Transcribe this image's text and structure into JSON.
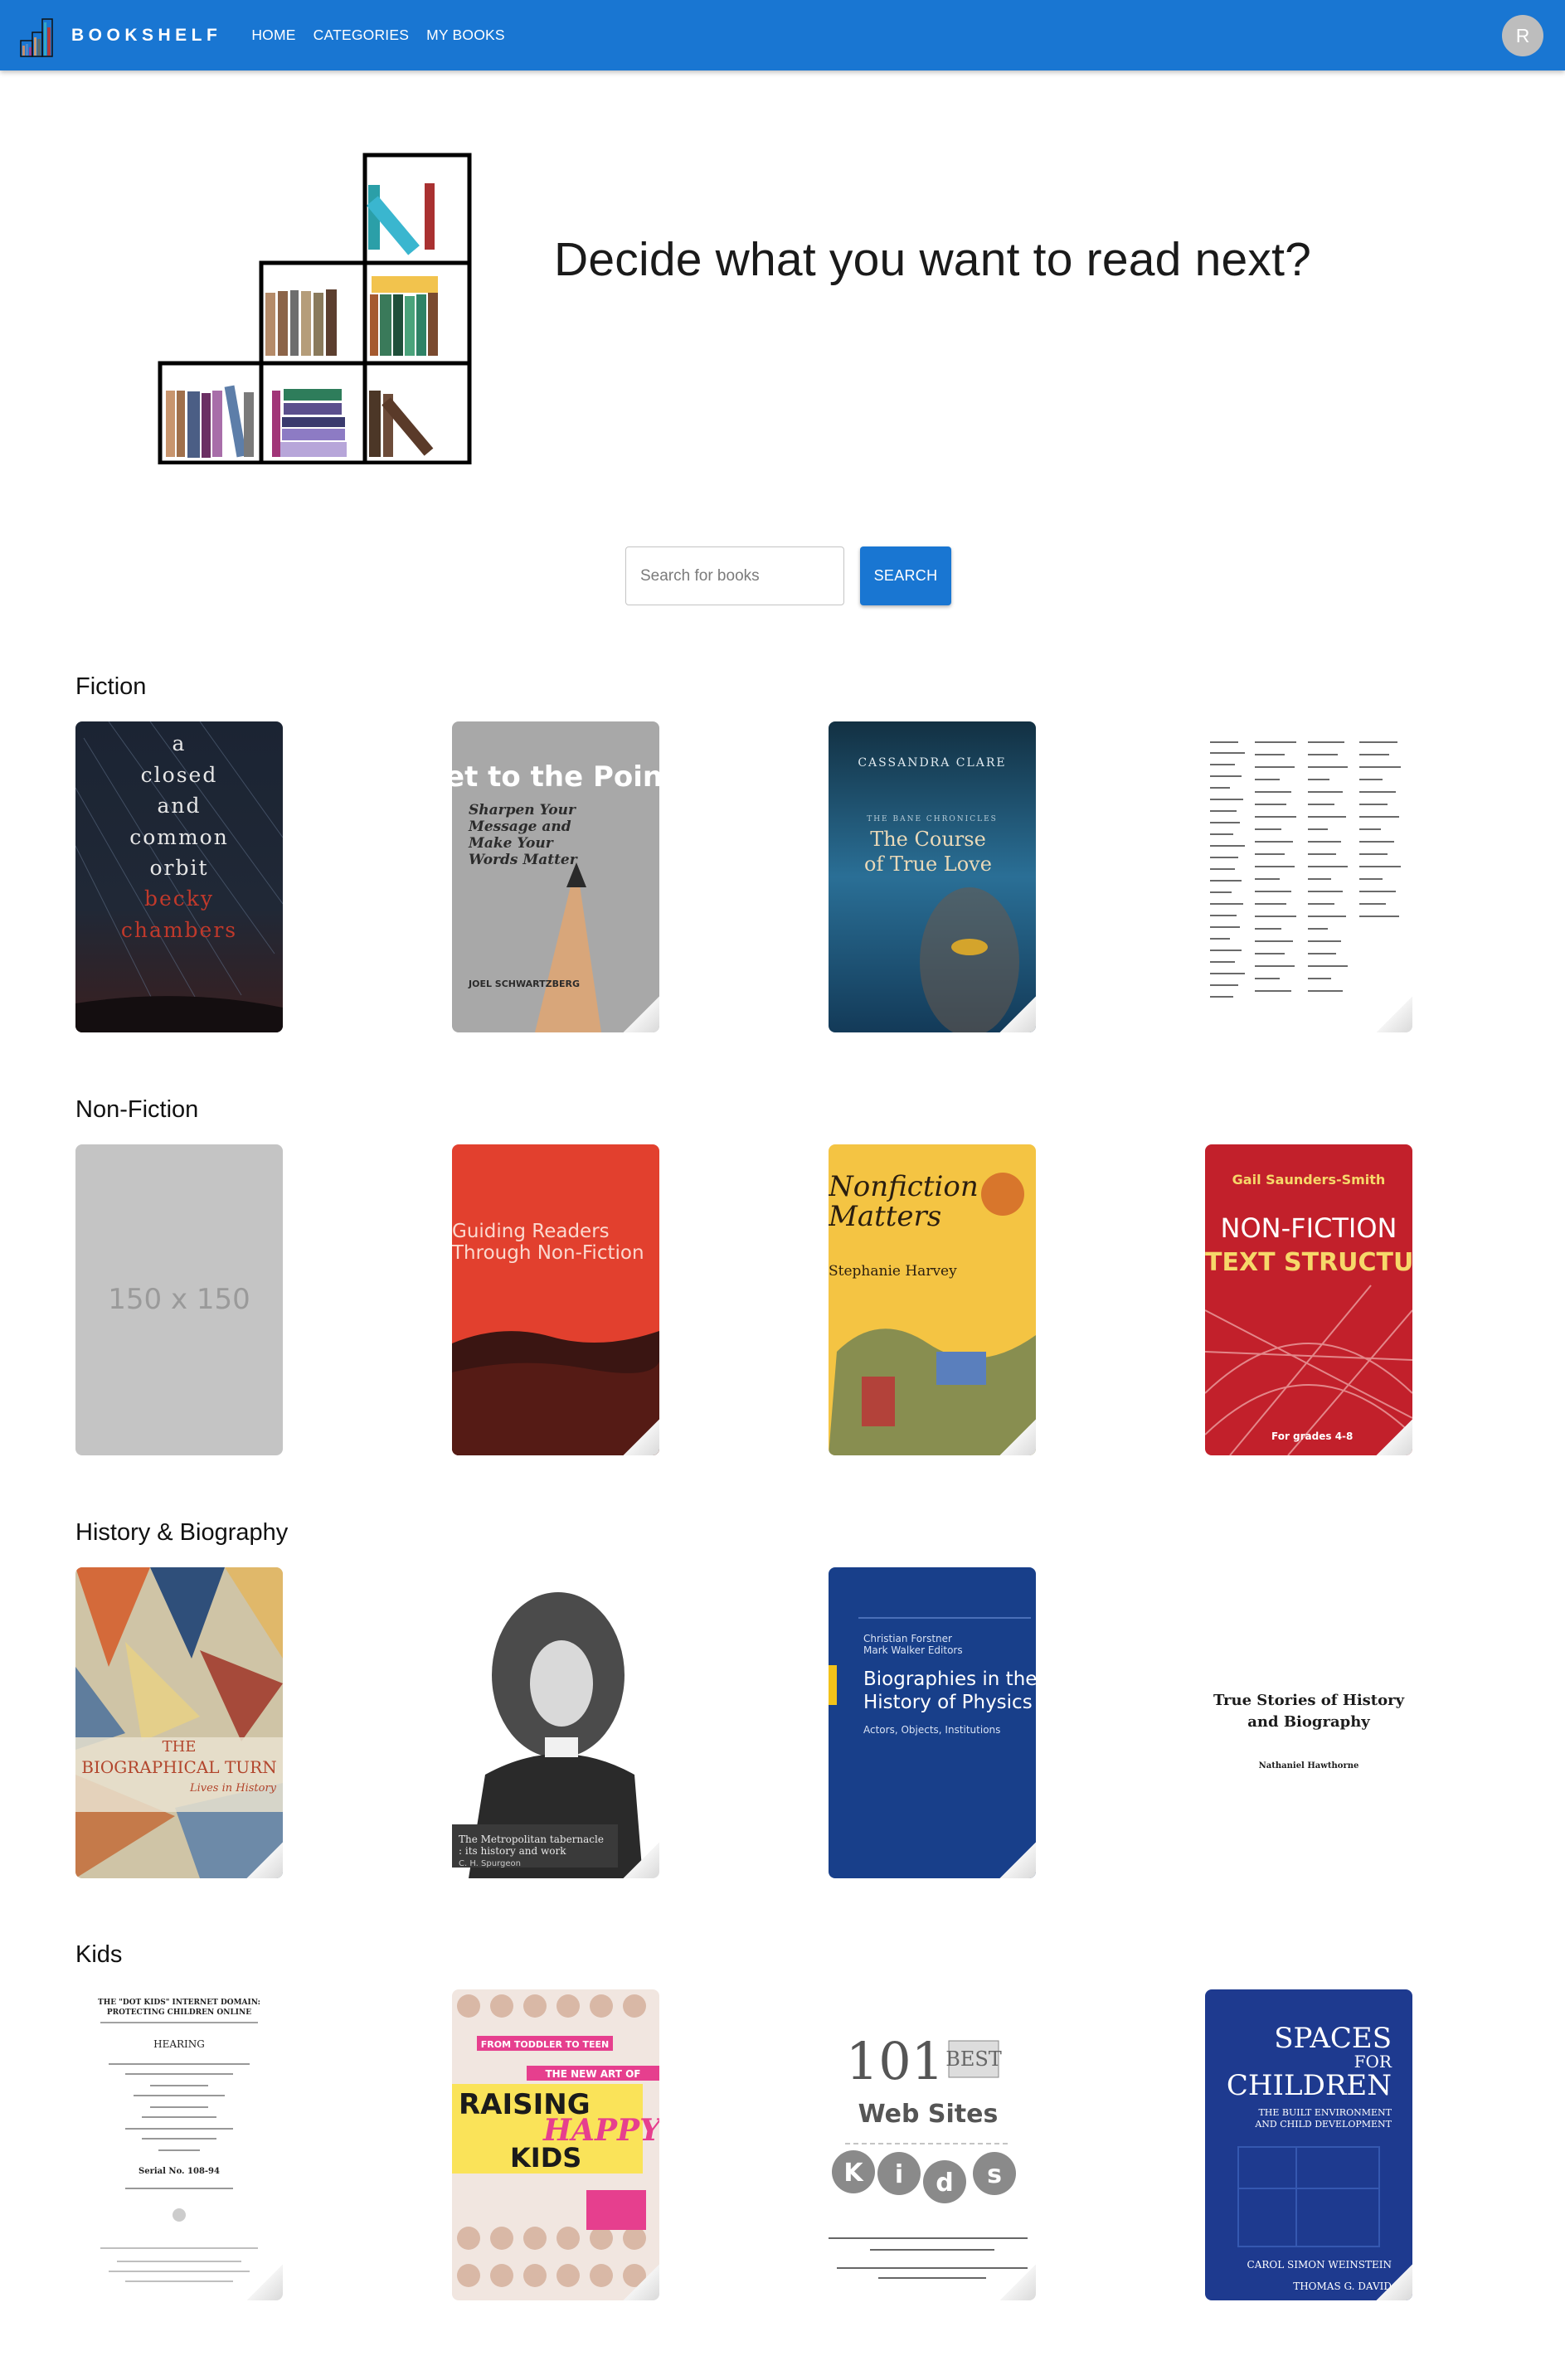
{
  "app": {
    "brand": "BOOKSHELF",
    "nav": [
      "HOME",
      "CATEGORIES",
      "MY BOOKS"
    ],
    "avatar_initial": "R",
    "colors": {
      "primary": "#1976d2",
      "avatar": "#bdbdbd"
    }
  },
  "hero": {
    "title": "Decide what you want to read next?"
  },
  "search": {
    "placeholder": "Search for books",
    "button_label": "SEARCH"
  },
  "categories": [
    {
      "name": "Fiction",
      "books": [
        {
          "cover_text": [
            "a",
            "closed",
            "and",
            "common",
            "orbit",
            "becky",
            "chambers"
          ]
        },
        {
          "cover_text": [
            "Get to the Point!",
            "Sharpen Your",
            "Message and",
            "Make Your",
            "Words Matter",
            "JOEL SCHWARTZBERG"
          ]
        },
        {
          "cover_text": [
            "CASSANDRA CLARE",
            "THE BANE CHRONICLES",
            "The Course",
            "of True Love"
          ]
        },
        {
          "cover_text": []
        }
      ]
    },
    {
      "name": "Non-Fiction",
      "books": [
        {
          "cover_text": [
            "150 x 150"
          ]
        },
        {
          "cover_text": [
            "Guiding Readers",
            "Through Non-Fiction"
          ]
        },
        {
          "cover_text": [
            "Nonfiction",
            "Matters",
            "Stephanie Harvey"
          ]
        },
        {
          "cover_text": [
            "Gail Saunders-Smith",
            "NON-FICTION",
            "TEXT STRUCTURES",
            "For grades 4-8"
          ]
        }
      ]
    },
    {
      "name": "History & Biography",
      "books": [
        {
          "cover_text": [
            "THE",
            "BIOGRAPHICAL TURN",
            "Lives in History"
          ]
        },
        {
          "cover_text": [
            "The Metropolitan tabernacle",
            ": its history and work",
            "C. H. Spurgeon"
          ]
        },
        {
          "cover_text": [
            "Christian Forstner",
            "Mark Walker  Editors",
            "Biographies in the",
            "History of Physics",
            "Actors, Objects, Institutions"
          ]
        },
        {
          "cover_text": [
            "True Stories of History",
            "and Biography",
            "Nathaniel Hawthorne"
          ]
        }
      ]
    },
    {
      "name": "Kids",
      "books": [
        {
          "cover_text": [
            "THE \"DOT KIDS\" INTERNET DOMAIN:",
            "PROTECTING CHILDREN ONLINE",
            "HEARING",
            "Serial No. 108-94"
          ]
        },
        {
          "cover_text": [
            "FROM TODDLER TO TEEN",
            "THE NEW ART OF",
            "RAISING",
            "HAPPY",
            "KIDS"
          ]
        },
        {
          "cover_text": [
            "101",
            "BEST",
            "Web Sites",
            "K",
            "i",
            "d",
            "s"
          ]
        },
        {
          "cover_text": [
            "SPACES",
            "FOR",
            "CHILDREN",
            "THE BUILT ENVIRONMENT",
            "AND CHILD DEVELOPMENT",
            "CAROL SIMON WEINSTEIN",
            "THOMAS G. DAVID"
          ]
        }
      ]
    }
  ]
}
